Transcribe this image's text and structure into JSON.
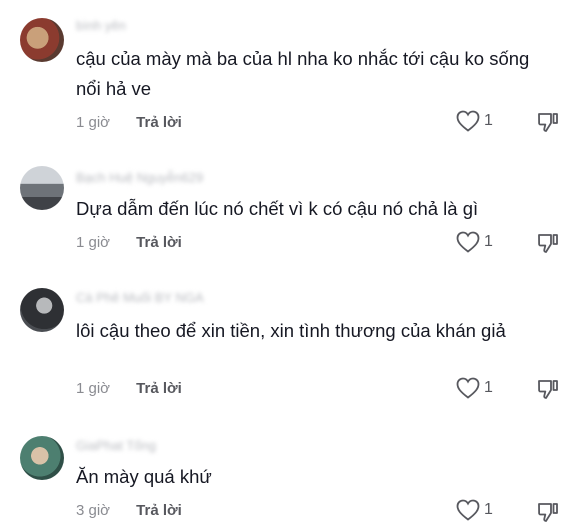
{
  "comments": [
    {
      "username": "bình yên",
      "avatar_color": "#6b4a3a",
      "text": "cậu của mày mà ba của hl nha ko nhắc tới cậu ko sống nổi hả ve",
      "time": "1 giờ",
      "reply_label": "Trả lời",
      "likes": "1"
    },
    {
      "username": "Bạch Huệ Nguyễn629",
      "avatar_color": "#7a7f86",
      "text": "Dựa dẫm đến lúc nó chết vì k có cậu nó chả là gì",
      "time": "1 giờ",
      "reply_label": "Trả lời",
      "likes": "1"
    },
    {
      "username": "Cà Phê Muối BY NGA",
      "avatar_color": "#3d3f44",
      "text": "lôi cậu theo để xin tiền, xin tình thương của khán giả",
      "time": "1 giờ",
      "reply_label": "Trả lời",
      "likes": "1"
    },
    {
      "username": "GiaPhat Tống",
      "avatar_color": "#5f8a7a",
      "text": "Ăn mày quá khứ",
      "time": "3 giờ",
      "reply_label": "Trả lời",
      "likes": "1"
    }
  ]
}
